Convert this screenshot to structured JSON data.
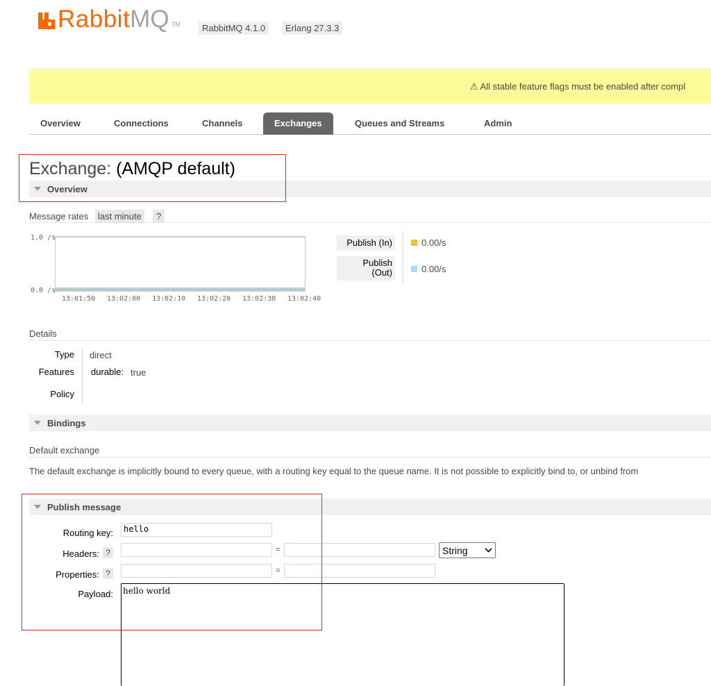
{
  "header": {
    "logo_rabbit": "Rabbit",
    "logo_mq": "MQ",
    "logo_tm": "TM",
    "rabbitmq_version": "RabbitMQ 4.1.0",
    "erlang_version": "Erlang 27.3.3"
  },
  "banner": {
    "text": "⚠ All stable feature flags must be enabled after compl",
    "color": "#fbfb99"
  },
  "tabs": [
    {
      "label": "Overview",
      "active": false
    },
    {
      "label": "Connections",
      "active": false
    },
    {
      "label": "Channels",
      "active": false
    },
    {
      "label": "Exchanges",
      "active": true
    },
    {
      "label": "Queues and Streams",
      "active": false
    },
    {
      "label": "Admin",
      "active": false
    }
  ],
  "page": {
    "title_prefix": "Exchange: ",
    "title_name": "(AMQP default)"
  },
  "overview": {
    "section_title": "Overview",
    "message_rates_label": "Message rates",
    "rate_period": "last minute",
    "help": "?"
  },
  "chart_data": {
    "type": "line",
    "y_ticks": [
      "1.0 /s",
      "0.0 /s"
    ],
    "x_ticks": [
      "13:01:50",
      "13:02:00",
      "13:02:10",
      "13:02:20",
      "13:02:30",
      "13:02:40"
    ],
    "ylim": [
      0,
      1
    ],
    "series": [
      {
        "name": "Publish (In)",
        "color": "#edc240",
        "values": [
          0,
          0,
          0,
          0,
          0,
          0
        ],
        "rate": "0.00/s"
      },
      {
        "name": "Publish (Out)",
        "color": "#afd8f8",
        "values": [
          0,
          0,
          0,
          0,
          0,
          0
        ],
        "rate": "0.00/s"
      }
    ]
  },
  "legend": {
    "publish_in": "Publish (In)",
    "publish_out_line1": "Publish",
    "publish_out_line2": "(Out)",
    "in_rate": "0.00/s",
    "out_rate": "0.00/s"
  },
  "details": {
    "heading": "Details",
    "type_key": "Type",
    "type_value": "direct",
    "features_key": "Features",
    "durable_key": "durable:",
    "durable_value": "true",
    "policy_key": "Policy"
  },
  "bindings": {
    "section_title": "Bindings",
    "subheading": "Default exchange",
    "description": "The default exchange is implicitly bound to every queue, with a routing key equal to the queue name. It is not possible to explicitly bind to, or unbind from"
  },
  "publish": {
    "section_title": "Publish message",
    "routing_key_label": "Routing key:",
    "routing_key_value": "hello",
    "headers_label": "Headers:",
    "properties_label": "Properties:",
    "payload_label": "Payload:",
    "payload_value": "hello world",
    "header_type_selected": "String",
    "equals": "=",
    "help": "?"
  }
}
